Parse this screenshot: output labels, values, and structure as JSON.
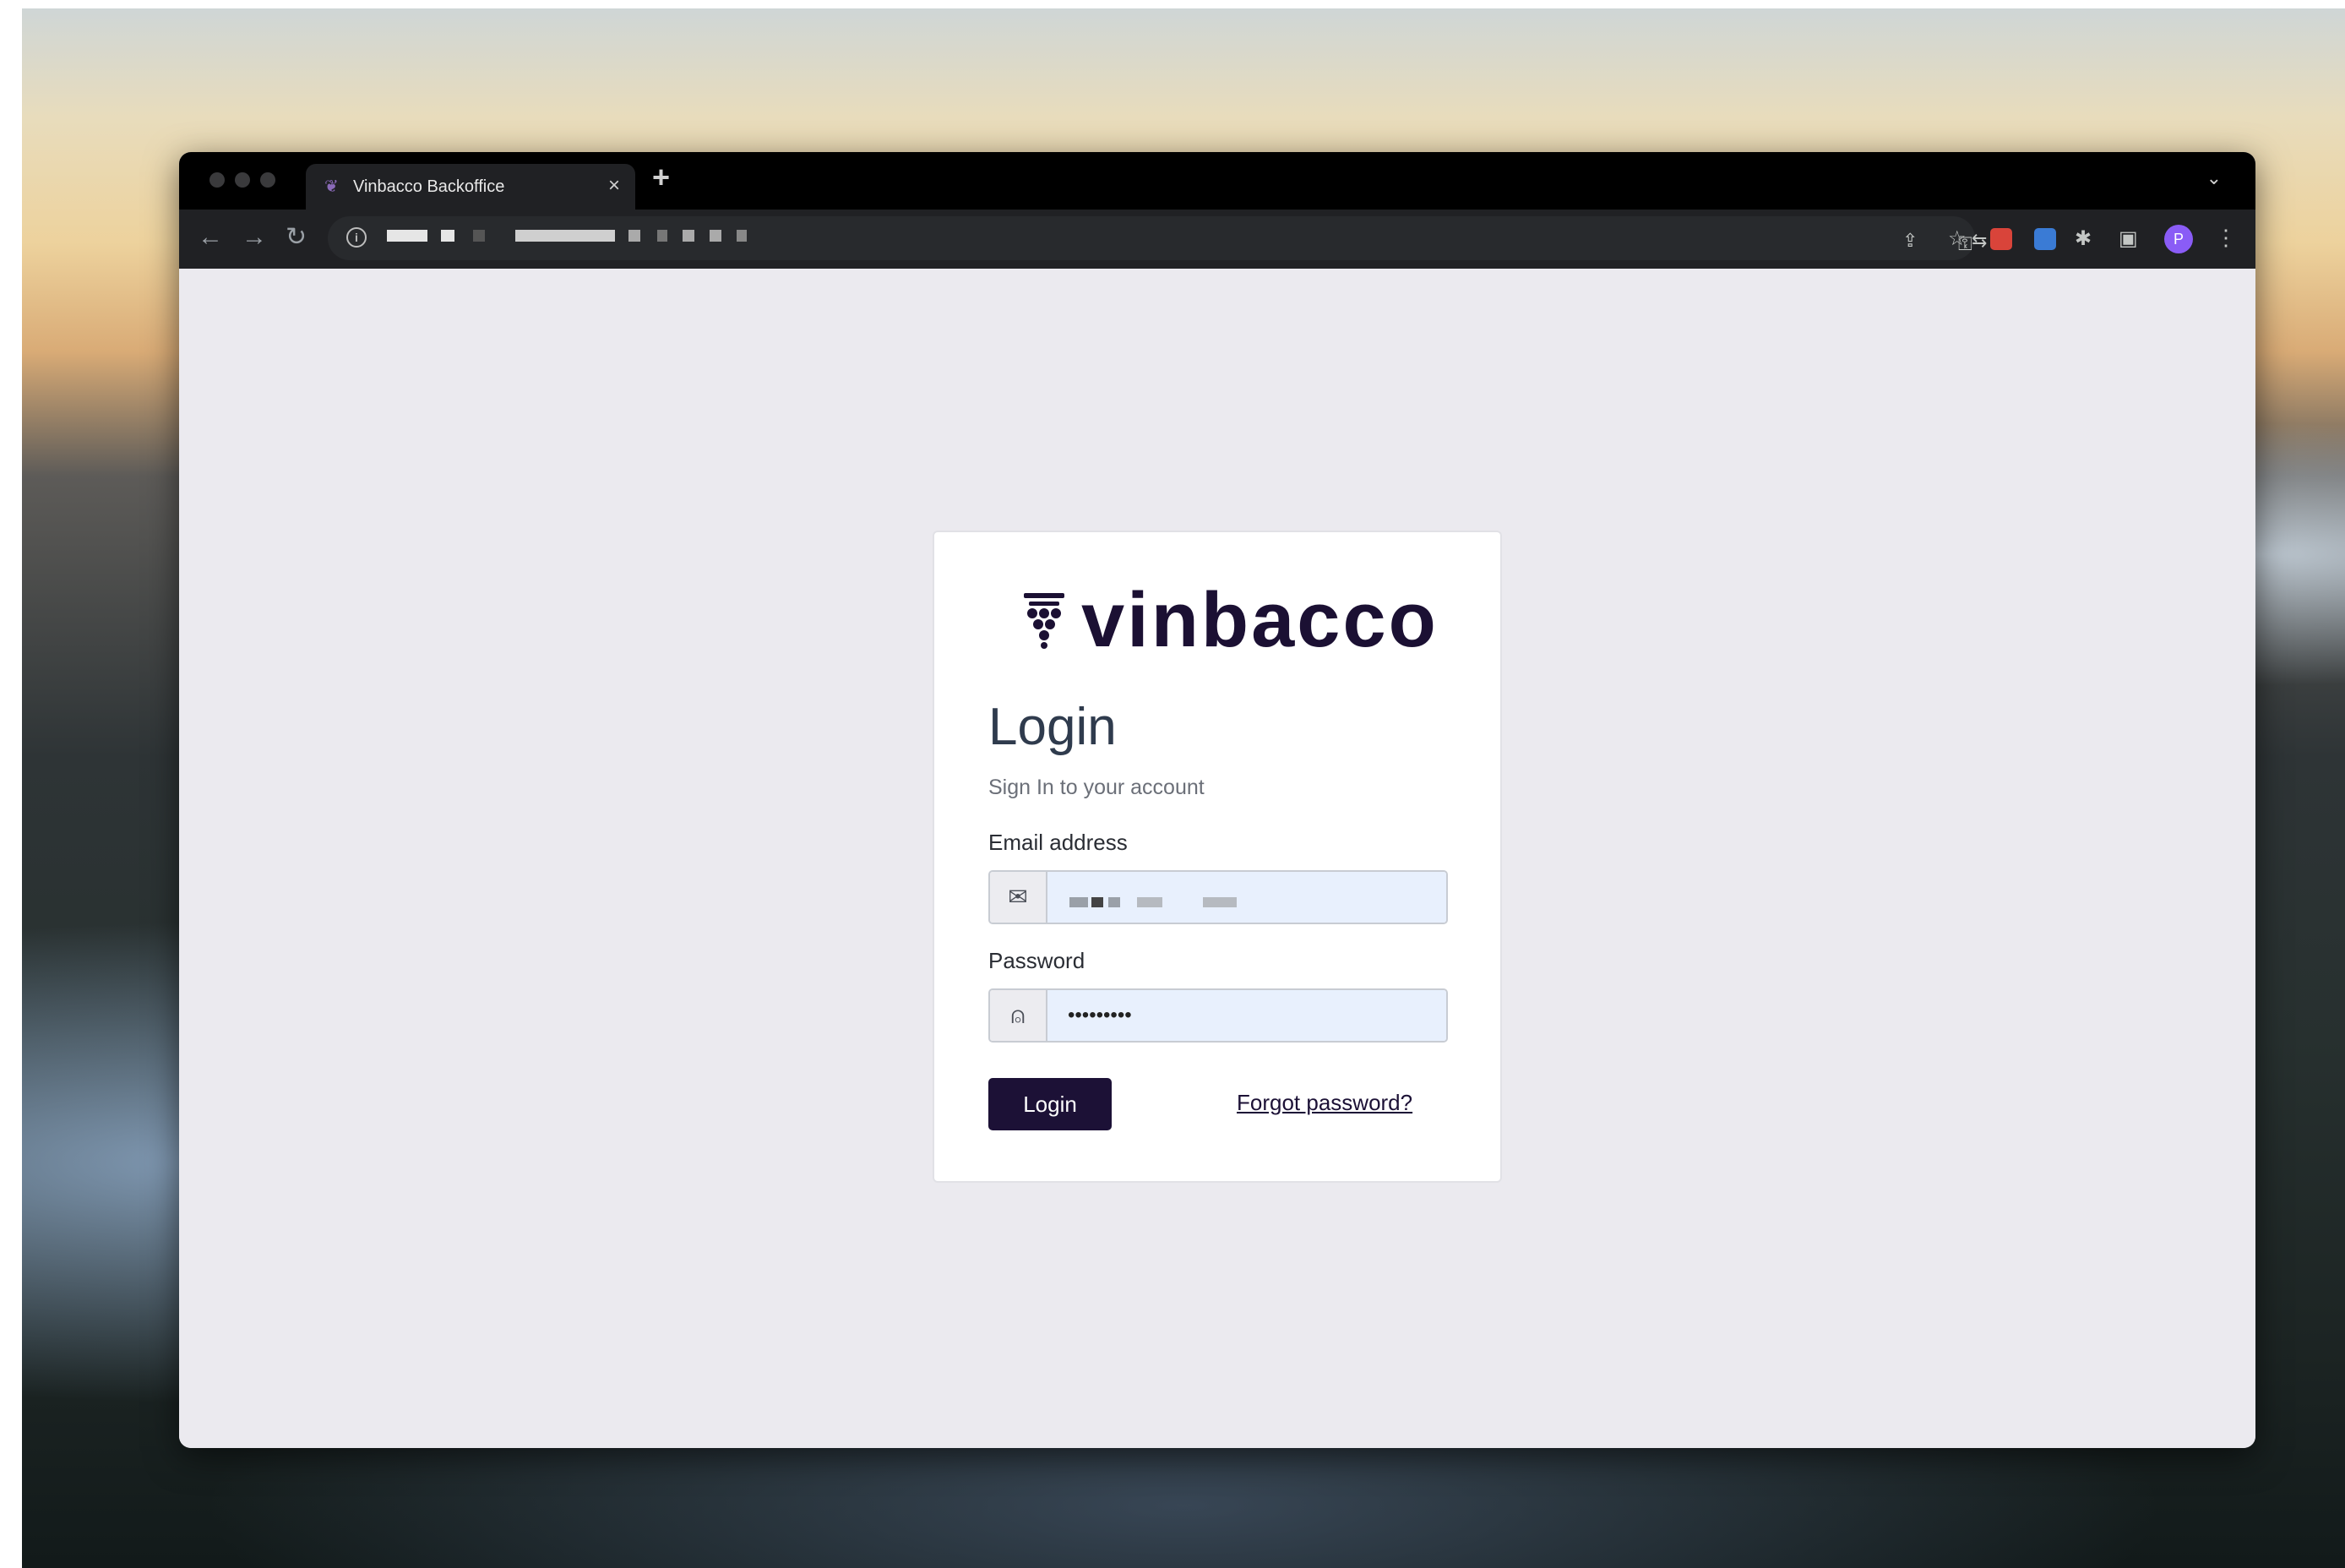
{
  "browser": {
    "tab_title": "Vinbacco Backoffice",
    "tab_close_glyph": "×",
    "new_tab_glyph": "+",
    "chevron_glyph": "⌄",
    "nav": {
      "back": "←",
      "forward": "→",
      "reload": "↻",
      "info": "i"
    },
    "toolbar_icons": [
      "key-icon",
      "translate-icon",
      "share-icon",
      "star-icon",
      "extension-red-icon",
      "extension-blue-icon",
      "puzzle-icon",
      "side-panel-icon"
    ],
    "profile_initial": "P"
  },
  "login": {
    "brand": "vinbacco",
    "title": "Login",
    "subtitle": "Sign In to your account",
    "email_label": "Email address",
    "password_label": "Password",
    "password_value": "•••••••••",
    "submit_label": "Login",
    "forgot_label": "Forgot password?"
  },
  "colors": {
    "brand_dark": "#1c1136",
    "input_autofill": "#e8f0fd",
    "page_bg": "#ebeaef"
  }
}
